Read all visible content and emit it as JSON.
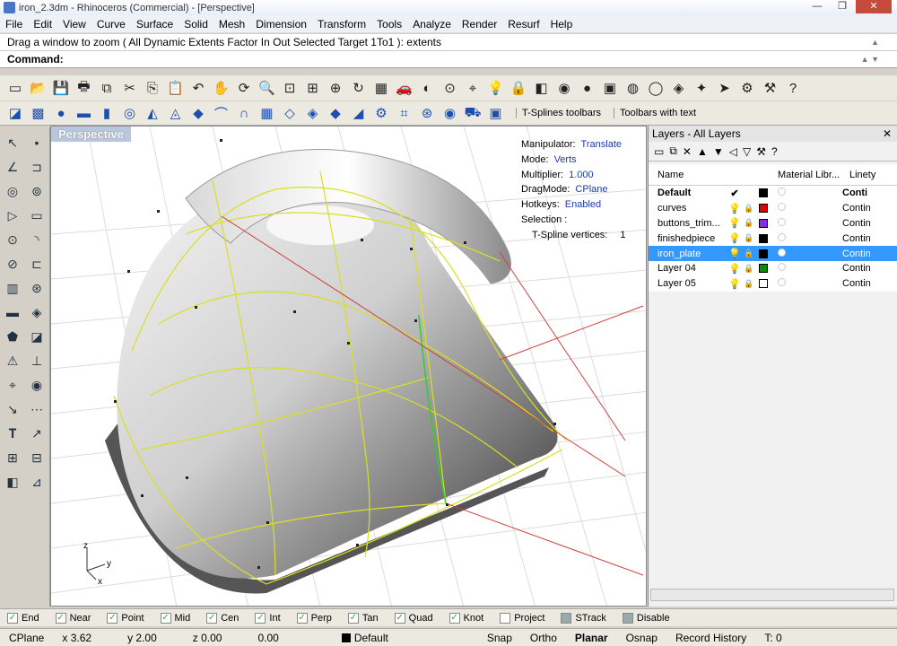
{
  "window": {
    "title": "iron_2.3dm - Rhinoceros (Commercial) - [Perspective]"
  },
  "menu": [
    "File",
    "Edit",
    "View",
    "Curve",
    "Surface",
    "Solid",
    "Mesh",
    "Dimension",
    "Transform",
    "Tools",
    "Analyze",
    "Render",
    "Resurf",
    "Help"
  ],
  "command": {
    "history": "Drag a window to zoom ( All  Dynamic  Extents  Factor  In  Out  Selected  Target  1To1 ): extents",
    "prompt": "Command:"
  },
  "toolbar": {
    "icons1": [
      "new-file-icon",
      "open-folder-icon",
      "save-icon",
      "print-icon",
      "copy-doc-icon",
      "cut-icon",
      "copy-icon",
      "paste-icon",
      "undo-icon",
      "pan-icon",
      "rotate-view-icon",
      "zoom-icon",
      "zoom-window-icon",
      "zoom-extents-icon",
      "zoom-selected-icon",
      "redraw-icon",
      "four-views-icon",
      "car-icon",
      "shaded-icon",
      "cplane-icon",
      "snap-icon",
      "light-icon",
      "lock-icon",
      "layer-icon",
      "color-wheel-icon",
      "sphere-icon",
      "render-icon",
      "teapot-icon",
      "globe-icon",
      "environment-icon",
      "render-settings-icon",
      "pointer-icon",
      "gear-icon",
      "settings-icon",
      "help-icon"
    ],
    "icons2": [
      "tsplines-box-icon",
      "tsplines-cube-icon",
      "tsplines-sphere-icon",
      "tsplines-plane-icon",
      "tsplines-cylinder-icon",
      "tsplines-torus-icon",
      "tsplines-extrude-icon",
      "tsplines-rail-icon",
      "tsplines-subd-icon",
      "tsplines-pipe-icon",
      "tsplines-loft-icon",
      "tsplines-grid-icon",
      "tsplines-append-icon",
      "tsplines-weld-icon",
      "tsplines-surface-icon",
      "tsplines-smooth-icon",
      "tsplines-gear-icon",
      "tsplines-net-icon",
      "tsplines-web-icon",
      "tsplines-ball-icon",
      "tsplines-cart-icon",
      "tsplines-box2-icon"
    ],
    "tsplines_label": "T-Splines toolbars",
    "toolbars_text_label": "Toolbars with text"
  },
  "viewport": {
    "title": "Perspective",
    "hud": [
      {
        "label": "Manipulator:",
        "value": "Translate"
      },
      {
        "label": "Mode:",
        "value": "Verts"
      },
      {
        "label": "Multiplier:",
        "value": "1.000"
      },
      {
        "label": "DragMode:",
        "value": "CPlane"
      },
      {
        "label": "Hotkeys:",
        "value": "Enabled"
      },
      {
        "label": "Selection :",
        "value": ""
      },
      {
        "label": "T-Spline vertices:",
        "value": "1"
      }
    ],
    "axis_z": "z",
    "axis_y": "y",
    "axis_x": "x"
  },
  "layers": {
    "title": "Layers - All Layers",
    "columns": {
      "name": "Name",
      "material": "Material Libr...",
      "linetype": "Linety"
    },
    "rows": [
      {
        "name": "Default",
        "color": "#000000",
        "linetype": "Conti",
        "current": true,
        "selected": false
      },
      {
        "name": "curves",
        "color": "#e00000",
        "linetype": "Contin",
        "current": false,
        "selected": false
      },
      {
        "name": "buttons_trim...",
        "color": "#8a2be2",
        "linetype": "Contin",
        "current": false,
        "selected": false
      },
      {
        "name": "finishedpiece",
        "color": "#000000",
        "linetype": "Contin",
        "current": false,
        "selected": false
      },
      {
        "name": "iron_plate",
        "color": "#000000",
        "linetype": "Contin",
        "current": false,
        "selected": true
      },
      {
        "name": "Layer 04",
        "color": "#0a8a0a",
        "linetype": "Contin",
        "current": false,
        "selected": false
      },
      {
        "name": "Layer 05",
        "color": "#ffffff",
        "linetype": "Contin",
        "current": false,
        "selected": false
      }
    ]
  },
  "osnaps": [
    {
      "label": "End",
      "checked": true
    },
    {
      "label": "Near",
      "checked": true
    },
    {
      "label": "Point",
      "checked": true
    },
    {
      "label": "Mid",
      "checked": true
    },
    {
      "label": "Cen",
      "checked": true
    },
    {
      "label": "Int",
      "checked": true
    },
    {
      "label": "Perp",
      "checked": true
    },
    {
      "label": "Tan",
      "checked": true
    },
    {
      "label": "Quad",
      "checked": true
    },
    {
      "label": "Knot",
      "checked": true
    },
    {
      "label": "Project",
      "checked": false
    },
    {
      "label": "STrack",
      "checked": false
    },
    {
      "label": "Disable",
      "checked": false
    }
  ],
  "status": {
    "cplane": "CPlane",
    "x": "x 3.62",
    "y": "y 2.00",
    "z": "z 0.00",
    "dist": "0.00",
    "layer": "Default",
    "snap": "Snap",
    "ortho": "Ortho",
    "planar": "Planar",
    "osnap": "Osnap",
    "record": "Record History",
    "t": "T: 0"
  }
}
